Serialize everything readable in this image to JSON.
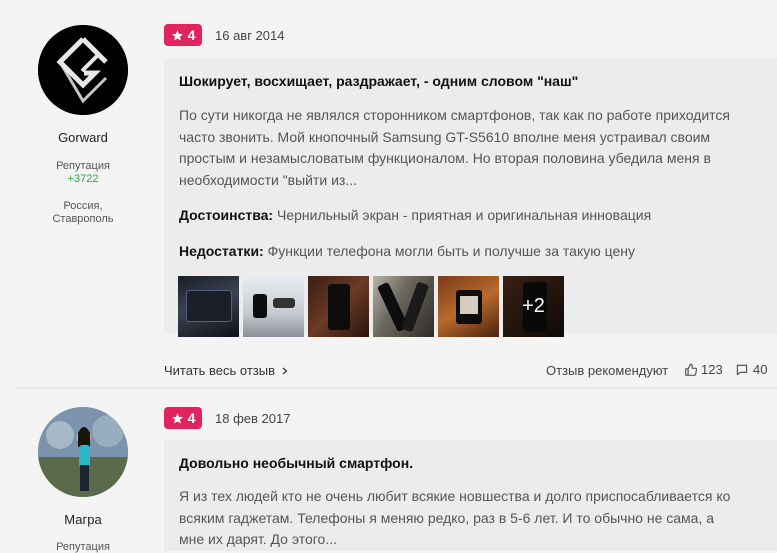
{
  "reviews": [
    {
      "author": "Gorward",
      "reputation_label": "Репутация",
      "reputation_value": "+3722",
      "location": "Россия,\nСтаврополь",
      "rating": "4",
      "date": "16 авг 2014",
      "title": "Шокирует, восхищает, раздражает, - одним словом \"наш\"",
      "text": "По сути никогда не являлся сторонником смартфонов, так как по работе приходится часто звонить. Мой кнопочный Samsung GT-S5610 вполне меня устраивал своим простым и незамысловатым функционалом. Но вторая половина убедила меня в необходимости \"выйти из...",
      "pros_label": "Достоинства:",
      "pros": "Чернильный экран - приятная и оригинальная инновация",
      "cons_label": "Недостатки:",
      "cons": "Функции телефона могли быть и получше за такую цену",
      "more_photos": "+2",
      "read_more": "Читать весь отзыв",
      "recommends": "Отзыв рекомендуют",
      "likes": "123",
      "comments": "40"
    },
    {
      "author": "Магра",
      "reputation_label": "Репутация",
      "rating": "4",
      "date": "18 фев 2017",
      "title": "Довольно необычный смартфон.",
      "text": "Я из тех людей кто не очень любит всякие новшества и долго приспосабливается ко всяким гаджетам. Телефоны я меняю редко, раз в 5-6 лет. И то обычно не сама, а мне их дарят. До этого..."
    }
  ],
  "icons": {
    "rating": "star-icon",
    "read_more": "chevron-right-icon",
    "likes": "thumbs-up-icon",
    "comments": "comment-icon"
  },
  "colors": {
    "rating_badge": "#e0245e",
    "reputation_positive": "#2aa83a",
    "content_background": "#ececec",
    "page_background": "#f4f4f4"
  }
}
